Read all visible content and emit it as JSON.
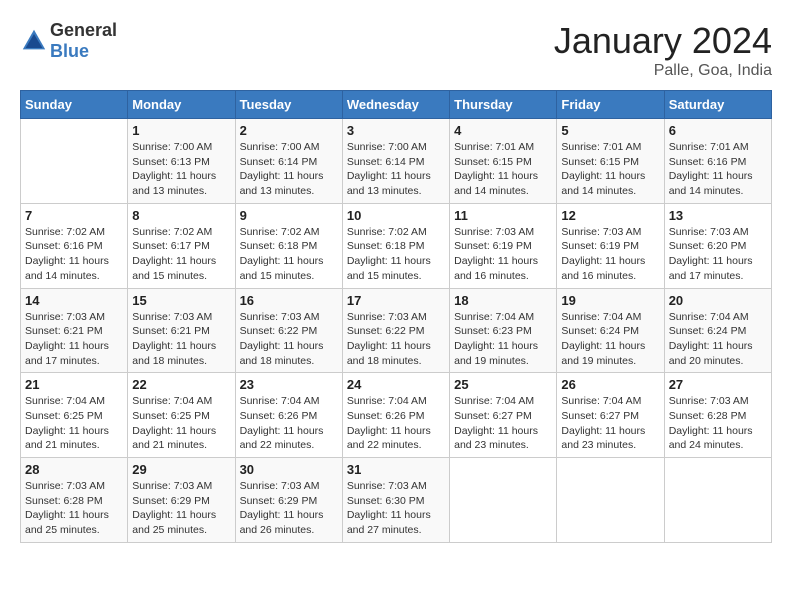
{
  "header": {
    "logo_general": "General",
    "logo_blue": "Blue",
    "month": "January 2024",
    "location": "Palle, Goa, India"
  },
  "weekdays": [
    "Sunday",
    "Monday",
    "Tuesday",
    "Wednesday",
    "Thursday",
    "Friday",
    "Saturday"
  ],
  "weeks": [
    [
      {
        "day": "",
        "sunrise": "",
        "sunset": "",
        "daylight": ""
      },
      {
        "day": "1",
        "sunrise": "Sunrise: 7:00 AM",
        "sunset": "Sunset: 6:13 PM",
        "daylight": "Daylight: 11 hours and 13 minutes."
      },
      {
        "day": "2",
        "sunrise": "Sunrise: 7:00 AM",
        "sunset": "Sunset: 6:14 PM",
        "daylight": "Daylight: 11 hours and 13 minutes."
      },
      {
        "day": "3",
        "sunrise": "Sunrise: 7:00 AM",
        "sunset": "Sunset: 6:14 PM",
        "daylight": "Daylight: 11 hours and 13 minutes."
      },
      {
        "day": "4",
        "sunrise": "Sunrise: 7:01 AM",
        "sunset": "Sunset: 6:15 PM",
        "daylight": "Daylight: 11 hours and 14 minutes."
      },
      {
        "day": "5",
        "sunrise": "Sunrise: 7:01 AM",
        "sunset": "Sunset: 6:15 PM",
        "daylight": "Daylight: 11 hours and 14 minutes."
      },
      {
        "day": "6",
        "sunrise": "Sunrise: 7:01 AM",
        "sunset": "Sunset: 6:16 PM",
        "daylight": "Daylight: 11 hours and 14 minutes."
      }
    ],
    [
      {
        "day": "7",
        "sunrise": "Sunrise: 7:02 AM",
        "sunset": "Sunset: 6:16 PM",
        "daylight": "Daylight: 11 hours and 14 minutes."
      },
      {
        "day": "8",
        "sunrise": "Sunrise: 7:02 AM",
        "sunset": "Sunset: 6:17 PM",
        "daylight": "Daylight: 11 hours and 15 minutes."
      },
      {
        "day": "9",
        "sunrise": "Sunrise: 7:02 AM",
        "sunset": "Sunset: 6:18 PM",
        "daylight": "Daylight: 11 hours and 15 minutes."
      },
      {
        "day": "10",
        "sunrise": "Sunrise: 7:02 AM",
        "sunset": "Sunset: 6:18 PM",
        "daylight": "Daylight: 11 hours and 15 minutes."
      },
      {
        "day": "11",
        "sunrise": "Sunrise: 7:03 AM",
        "sunset": "Sunset: 6:19 PM",
        "daylight": "Daylight: 11 hours and 16 minutes."
      },
      {
        "day": "12",
        "sunrise": "Sunrise: 7:03 AM",
        "sunset": "Sunset: 6:19 PM",
        "daylight": "Daylight: 11 hours and 16 minutes."
      },
      {
        "day": "13",
        "sunrise": "Sunrise: 7:03 AM",
        "sunset": "Sunset: 6:20 PM",
        "daylight": "Daylight: 11 hours and 17 minutes."
      }
    ],
    [
      {
        "day": "14",
        "sunrise": "Sunrise: 7:03 AM",
        "sunset": "Sunset: 6:21 PM",
        "daylight": "Daylight: 11 hours and 17 minutes."
      },
      {
        "day": "15",
        "sunrise": "Sunrise: 7:03 AM",
        "sunset": "Sunset: 6:21 PM",
        "daylight": "Daylight: 11 hours and 18 minutes."
      },
      {
        "day": "16",
        "sunrise": "Sunrise: 7:03 AM",
        "sunset": "Sunset: 6:22 PM",
        "daylight": "Daylight: 11 hours and 18 minutes."
      },
      {
        "day": "17",
        "sunrise": "Sunrise: 7:03 AM",
        "sunset": "Sunset: 6:22 PM",
        "daylight": "Daylight: 11 hours and 18 minutes."
      },
      {
        "day": "18",
        "sunrise": "Sunrise: 7:04 AM",
        "sunset": "Sunset: 6:23 PM",
        "daylight": "Daylight: 11 hours and 19 minutes."
      },
      {
        "day": "19",
        "sunrise": "Sunrise: 7:04 AM",
        "sunset": "Sunset: 6:24 PM",
        "daylight": "Daylight: 11 hours and 19 minutes."
      },
      {
        "day": "20",
        "sunrise": "Sunrise: 7:04 AM",
        "sunset": "Sunset: 6:24 PM",
        "daylight": "Daylight: 11 hours and 20 minutes."
      }
    ],
    [
      {
        "day": "21",
        "sunrise": "Sunrise: 7:04 AM",
        "sunset": "Sunset: 6:25 PM",
        "daylight": "Daylight: 11 hours and 21 minutes."
      },
      {
        "day": "22",
        "sunrise": "Sunrise: 7:04 AM",
        "sunset": "Sunset: 6:25 PM",
        "daylight": "Daylight: 11 hours and 21 minutes."
      },
      {
        "day": "23",
        "sunrise": "Sunrise: 7:04 AM",
        "sunset": "Sunset: 6:26 PM",
        "daylight": "Daylight: 11 hours and 22 minutes."
      },
      {
        "day": "24",
        "sunrise": "Sunrise: 7:04 AM",
        "sunset": "Sunset: 6:26 PM",
        "daylight": "Daylight: 11 hours and 22 minutes."
      },
      {
        "day": "25",
        "sunrise": "Sunrise: 7:04 AM",
        "sunset": "Sunset: 6:27 PM",
        "daylight": "Daylight: 11 hours and 23 minutes."
      },
      {
        "day": "26",
        "sunrise": "Sunrise: 7:04 AM",
        "sunset": "Sunset: 6:27 PM",
        "daylight": "Daylight: 11 hours and 23 minutes."
      },
      {
        "day": "27",
        "sunrise": "Sunrise: 7:03 AM",
        "sunset": "Sunset: 6:28 PM",
        "daylight": "Daylight: 11 hours and 24 minutes."
      }
    ],
    [
      {
        "day": "28",
        "sunrise": "Sunrise: 7:03 AM",
        "sunset": "Sunset: 6:28 PM",
        "daylight": "Daylight: 11 hours and 25 minutes."
      },
      {
        "day": "29",
        "sunrise": "Sunrise: 7:03 AM",
        "sunset": "Sunset: 6:29 PM",
        "daylight": "Daylight: 11 hours and 25 minutes."
      },
      {
        "day": "30",
        "sunrise": "Sunrise: 7:03 AM",
        "sunset": "Sunset: 6:29 PM",
        "daylight": "Daylight: 11 hours and 26 minutes."
      },
      {
        "day": "31",
        "sunrise": "Sunrise: 7:03 AM",
        "sunset": "Sunset: 6:30 PM",
        "daylight": "Daylight: 11 hours and 27 minutes."
      },
      {
        "day": "",
        "sunrise": "",
        "sunset": "",
        "daylight": ""
      },
      {
        "day": "",
        "sunrise": "",
        "sunset": "",
        "daylight": ""
      },
      {
        "day": "",
        "sunrise": "",
        "sunset": "",
        "daylight": ""
      }
    ]
  ]
}
